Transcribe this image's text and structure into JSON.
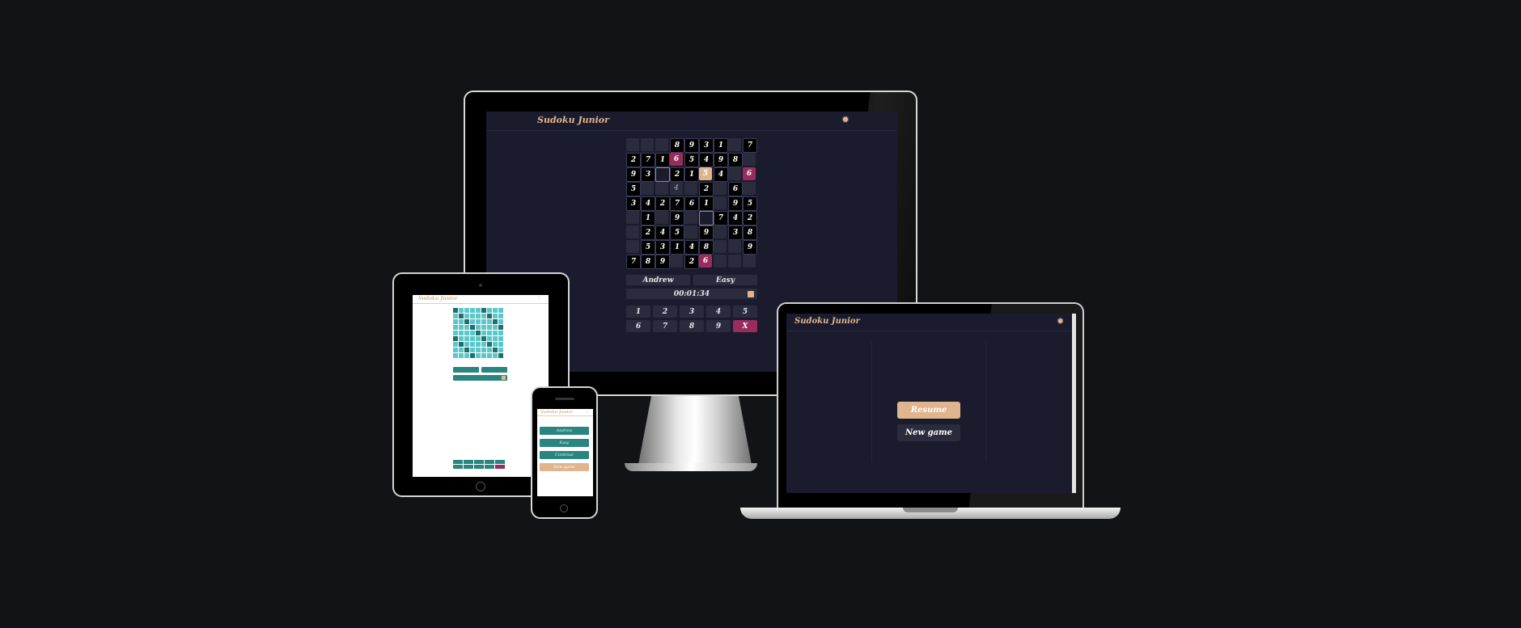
{
  "monitor": {
    "app_title": "Sudoku Junior",
    "gear_icon": "gear-icon",
    "player_name": "Andrew",
    "difficulty": "Easy",
    "timer": "00:01:34",
    "numpad": [
      "1",
      "2",
      "3",
      "4",
      "5",
      "6",
      "7",
      "8",
      "9",
      "X"
    ],
    "board": [
      [
        "",
        "",
        "",
        "8",
        "9",
        "3",
        "1",
        "",
        "7"
      ],
      [
        "2",
        "7",
        "1",
        "6",
        "5",
        "4",
        "9",
        "8",
        ""
      ],
      [
        "9",
        "3",
        "",
        "2",
        "1",
        "5",
        "4",
        "",
        "6"
      ],
      [
        "5",
        "",
        "",
        "4",
        "",
        "2",
        "",
        "6",
        ""
      ],
      [
        "3",
        "4",
        "2",
        "7",
        "6",
        "1",
        "",
        "9",
        "5"
      ],
      [
        "",
        "1",
        "",
        "9",
        "",
        "",
        "7",
        "4",
        "2"
      ],
      [
        "",
        "2",
        "4",
        "5",
        "",
        "9",
        "",
        "3",
        "8"
      ],
      [
        "",
        "5",
        "3",
        "1",
        "4",
        "8",
        "",
        "",
        "9"
      ],
      [
        "7",
        "8",
        "9",
        "",
        "2",
        "6",
        "",
        "",
        ""
      ]
    ]
  },
  "laptop": {
    "app_title": "Sudoku Junior",
    "resume_label": "Resume",
    "new_game_label": "New game"
  },
  "tablet": {
    "app_title": "Sudoku Junior"
  },
  "phone": {
    "app_title": "Sudoku Junior",
    "buttons": [
      "Andrew",
      "Easy",
      "Continue",
      "New game"
    ]
  },
  "colors": {
    "accent": "#e0b48c",
    "highlight": "#9a2c5d",
    "dark_bg": "#1b1b2e",
    "teal": "#2a8580"
  }
}
